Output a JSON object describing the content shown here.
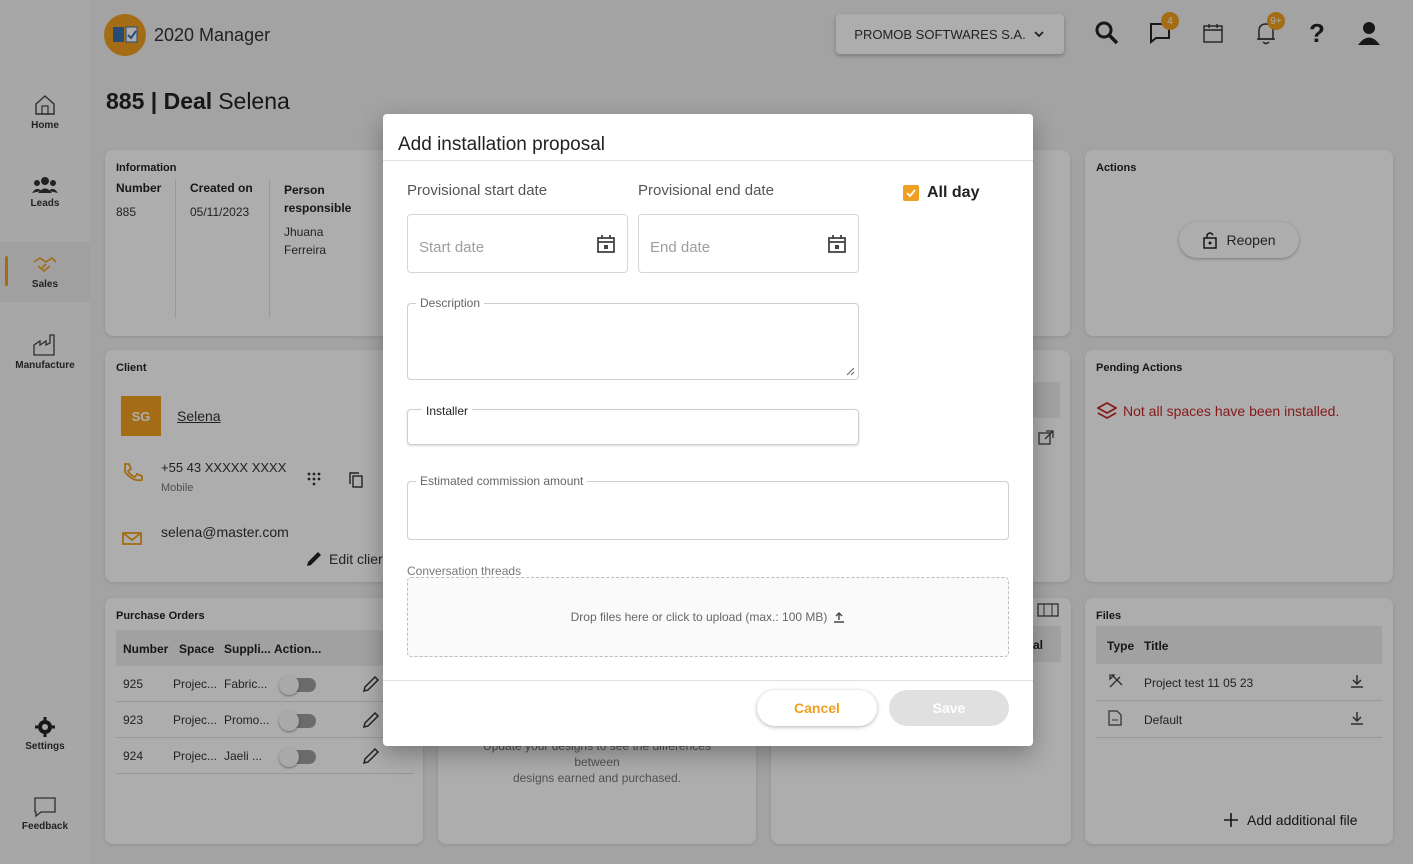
{
  "app": {
    "name": "2020 Manager",
    "company": "PROMOB SOFTWARES S.A.",
    "accent": "#f0a020"
  },
  "nav": [
    {
      "label": "Home",
      "icon": "home-icon"
    },
    {
      "label": "Leads",
      "icon": "people-icon"
    },
    {
      "label": "Sales",
      "icon": "handshake-icon",
      "active": true
    },
    {
      "label": "Manufacture",
      "icon": "factory-icon"
    },
    {
      "label": "Settings",
      "icon": "gear-icon"
    },
    {
      "label": "Feedback",
      "icon": "chat-icon"
    }
  ],
  "header": {
    "messages_count": "4",
    "alerts_count": "9+",
    "help": "?"
  },
  "page": {
    "deal_id": "885 | Deal",
    "deal_sep": " | ",
    "deal_name": "Selena"
  },
  "information": {
    "title": "Information",
    "number_label": "Number",
    "number": "885",
    "created_label": "Created on",
    "created": "05/11/2023",
    "person_label": "Person responsible",
    "person": "Jhuana Ferreira"
  },
  "actions": {
    "title": "Actions",
    "reopen": "Reopen"
  },
  "client": {
    "title": "Client",
    "initials": "SG",
    "name": "Selena",
    "phone": "+55 43 XXXXX XXXX",
    "phone_type": "Mobile",
    "email": "selena@master.com",
    "edit": "Edit clier"
  },
  "pending": {
    "title": "Pending Actions",
    "item": "Not all spaces have been installed."
  },
  "purchase_orders": {
    "title": "Purchase Orders",
    "columns": [
      "Number",
      "Space",
      "Suppli...",
      "Action..."
    ],
    "rows": [
      {
        "number": "925",
        "space": "Projec...",
        "supplier": "Fabric..."
      },
      {
        "number": "923",
        "space": "Projec...",
        "supplier": "Promo..."
      },
      {
        "number": "924",
        "space": "Projec...",
        "supplier": "Jaeli ..."
      }
    ]
  },
  "designs_note": {
    "line1": "Update your designs to see the differences",
    "line2": "between",
    "line3": "designs earned and purchased."
  },
  "mid_col_partial": "al",
  "files": {
    "title": "Files",
    "col_type": "Type",
    "col_title": "Title",
    "rows": [
      {
        "title": "Project test 11 05 23"
      },
      {
        "title": "Default"
      }
    ],
    "add": "Add additional file"
  },
  "modal": {
    "title": "Add installation proposal",
    "start_label": "Provisional start date",
    "end_label": "Provisional end date",
    "start_placeholder": "Start date",
    "end_placeholder": "End date",
    "all_day": "All day",
    "description_label": "Description",
    "installer_label": "Installer",
    "commission_label": "Estimated commission amount",
    "threads_label": "Conversation threads",
    "drop_text": "Drop files here or click to upload (max.: 100 MB)",
    "cancel": "Cancel",
    "save": "Save"
  }
}
